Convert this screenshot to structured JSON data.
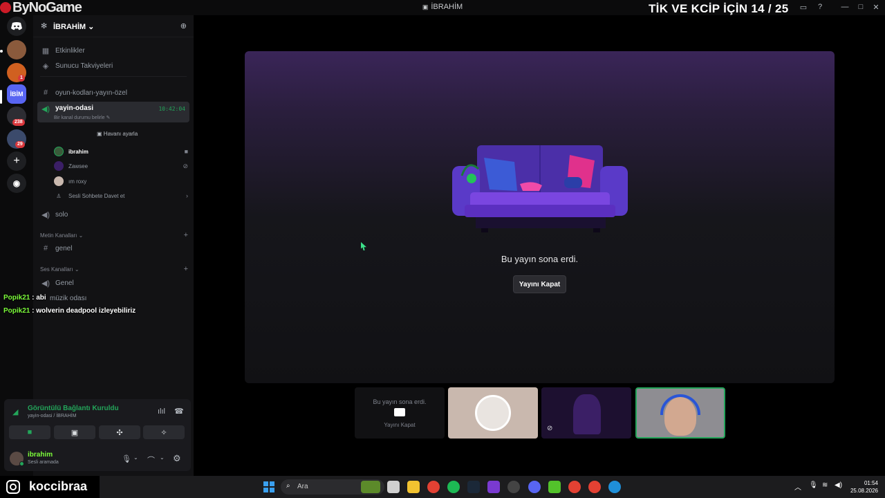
{
  "titlebar": {
    "brand": "ByNoGame",
    "window_title": "İBRAHİM",
    "overlay_title": "TİK VE KCİP İÇİN 14 / 25"
  },
  "rail": {
    "badges": [
      "1",
      "238",
      "29"
    ],
    "active_label": "İBİM"
  },
  "server": {
    "name": "İBRAHİM",
    "nav": [
      {
        "label": "Etkinlikler",
        "icon": "calendar-icon"
      },
      {
        "label": "Sunucu Takviyeleri",
        "icon": "boost-icon"
      }
    ],
    "channels": {
      "text_top": "oyun-kodları-yayın-özel",
      "active_voice": {
        "name": "yayin-odasi",
        "status": "Bir kanal durumu belirle",
        "timer": "10:42:04",
        "set_avatar": "Havanı ayarla",
        "members": [
          {
            "name": "ibrahim",
            "color": "#ffffff"
          },
          {
            "name": "Zawsee",
            "color": "#949ba4"
          },
          {
            "name": "ım roxy",
            "color": "#949ba4"
          }
        ],
        "invite": "Sesli Sohbete Davet et"
      },
      "solo": "solo",
      "text_category": "Metin Kanalları",
      "text_general": "genel",
      "voice_category": "Ses Kanalları",
      "voice_general": "Genel",
      "music": "müzik odası"
    }
  },
  "chat": [
    {
      "user": "Popik21",
      "message": "abi"
    },
    {
      "user": "Popik21",
      "message": "wolverin deadpool izleyebiliriz"
    }
  ],
  "voice_panel": {
    "status": "Görüntülü Bağlantı Kuruldu",
    "location": "yayin-odasi / İBRAHİM",
    "user_name": "ibrahim",
    "user_status": "Sesli aramada"
  },
  "stage": {
    "message": "Bu yayın sona erdi.",
    "close_button": "Yayını Kapat"
  },
  "tiles": {
    "ended_message": "Bu yayın sona erdi.",
    "ended_button": "Yayını Kapat"
  },
  "bottom": {
    "instagram": "koccibraa",
    "search_placeholder": "Ara",
    "time": "01:54",
    "date": "25.08.2026"
  }
}
